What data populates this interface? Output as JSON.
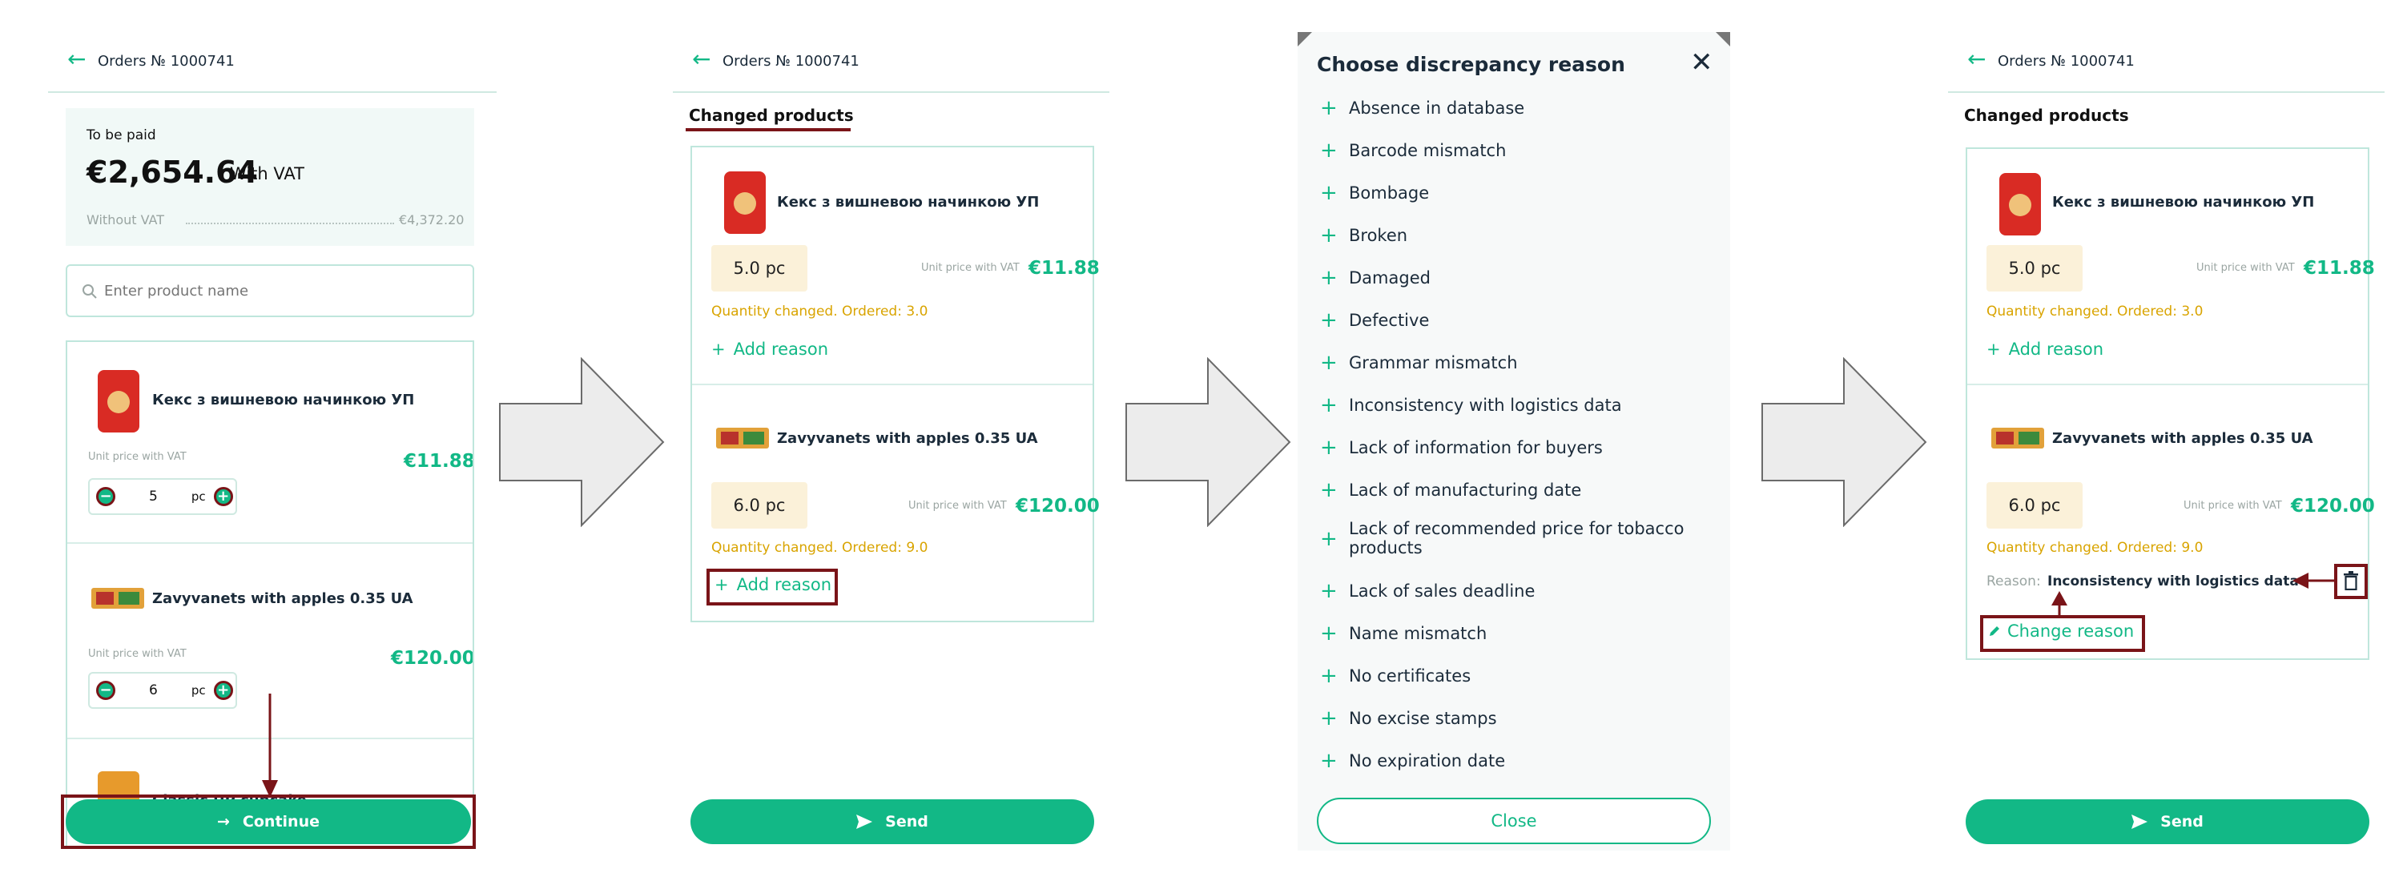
{
  "colors": {
    "accent": "#12b886",
    "annotation": "#7a1418",
    "warning": "#d9a400",
    "chip_bg": "#fbf1d9",
    "card_border": "#bfe6dc"
  },
  "header": {
    "title": "Orders № 1000741"
  },
  "screen1": {
    "to_be_paid_label": "To be paid",
    "amount": "€2,654.64",
    "with_vat": "With VAT",
    "without_vat_label": "Without VAT",
    "without_vat_value": "€4,372.20",
    "search_placeholder": "Enter product name",
    "products": [
      {
        "name": "Кекс з вишневою начинкою УП",
        "unit_label": "Unit price with VAT",
        "price": "€11.88",
        "qty": "5",
        "unit": "pc"
      },
      {
        "name": "Zavyvanets with apples 0.35 UA",
        "unit_label": "Unit price with VAT",
        "price": "€120.00",
        "qty": "6",
        "unit": "pc"
      },
      {
        "name": "Classic UP cupcake"
      }
    ],
    "continue_label": "Continue"
  },
  "screen2": {
    "section_title": "Changed products",
    "products": [
      {
        "name": "Кекс з вишневою начинкою УП",
        "qty": "5.0 pc",
        "unit_label": "Unit price with VAT",
        "price": "€11.88",
        "status": "Quantity changed. Ordered: 3.0",
        "add_reason": "Add reason"
      },
      {
        "name": "Zavyvanets with apples 0.35 UA",
        "qty": "6.0 pc",
        "unit_label": "Unit price with VAT",
        "price": "€120.00",
        "status": "Quantity changed. Ordered: 9.0",
        "add_reason": "Add reason"
      }
    ],
    "send_label": "Send"
  },
  "screen3": {
    "title": "Choose discrepancy reason",
    "reasons": [
      "Absence in database",
      "Barcode mismatch",
      "Bombage",
      "Broken",
      "Damaged",
      "Defective",
      "Grammar mismatch",
      "Inconsistency with logistics data",
      "Lack of information for buyers",
      "Lack of manufacturing date",
      "Lack of recommended price for tobacco products",
      "Lack of sales deadline",
      "Name mismatch",
      "No certificates",
      "No excise stamps",
      "No expiration date"
    ],
    "close_label": "Close"
  },
  "screen4": {
    "section_title": "Changed products",
    "products": [
      {
        "name": "Кекс з вишневою начинкою УП",
        "qty": "5.0 pc",
        "unit_label": "Unit price with VAT",
        "price": "€11.88",
        "status": "Quantity changed. Ordered: 3.0",
        "add_reason": "Add reason"
      },
      {
        "name": "Zavyvanets with apples 0.35 UA",
        "qty": "6.0 pc",
        "unit_label": "Unit price with VAT",
        "price": "€120.00",
        "status": "Quantity changed. Ordered: 9.0",
        "reason_label": "Reason:",
        "reason_value": "Inconsistency with logistics data",
        "change_reason": "Change reason"
      }
    ],
    "send_label": "Send"
  }
}
